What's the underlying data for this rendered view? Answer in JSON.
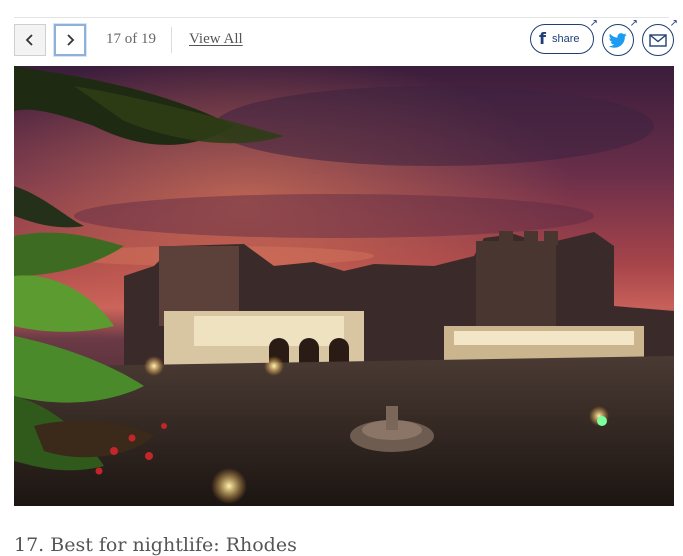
{
  "gallery": {
    "prev_label": "Previous",
    "next_label": "Next",
    "counter": "17 of 19",
    "view_all": "View All"
  },
  "share": {
    "facebook_label": "share",
    "icons": [
      "facebook-icon",
      "twitter-icon",
      "email-icon"
    ]
  },
  "image": {
    "alt": "Rhodes old town square at dusk"
  },
  "caption": {
    "text": "17. Best for nightlife: Rhodes"
  },
  "colors": {
    "brand_navy": "#1f3f73",
    "twitter_blue": "#1d9bf0",
    "focus_ring": "#8fb0d8"
  }
}
